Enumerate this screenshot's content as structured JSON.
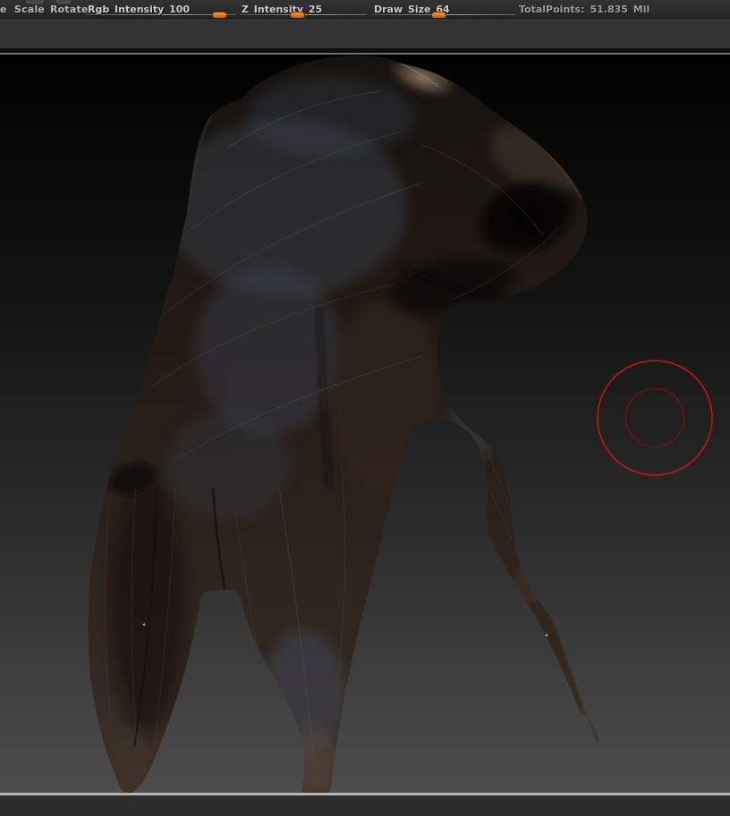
{
  "toolbar": {
    "partial_button": {
      "label": "e"
    },
    "buttons": [
      {
        "label": "Scale"
      },
      {
        "label": "Rotate"
      }
    ],
    "sliders": [
      {
        "label": "Rgb Intensity",
        "value": "100"
      },
      {
        "label": "Z Intensity",
        "value": "25"
      },
      {
        "label": "Draw Size",
        "value": "64"
      }
    ],
    "status": {
      "label": "TotalPoints:",
      "value": "51.835 Mil"
    }
  },
  "colors": {
    "slider_handle_orange": "#ec6f0d",
    "brush_cursor_outer_red": "#c41616",
    "brush_cursor_inner_red": "#7d1212",
    "toolbar_background": "#2c2c2c",
    "canvas_gradient_top": "#010101",
    "canvas_gradient_bottom": "#4d4d4d"
  }
}
